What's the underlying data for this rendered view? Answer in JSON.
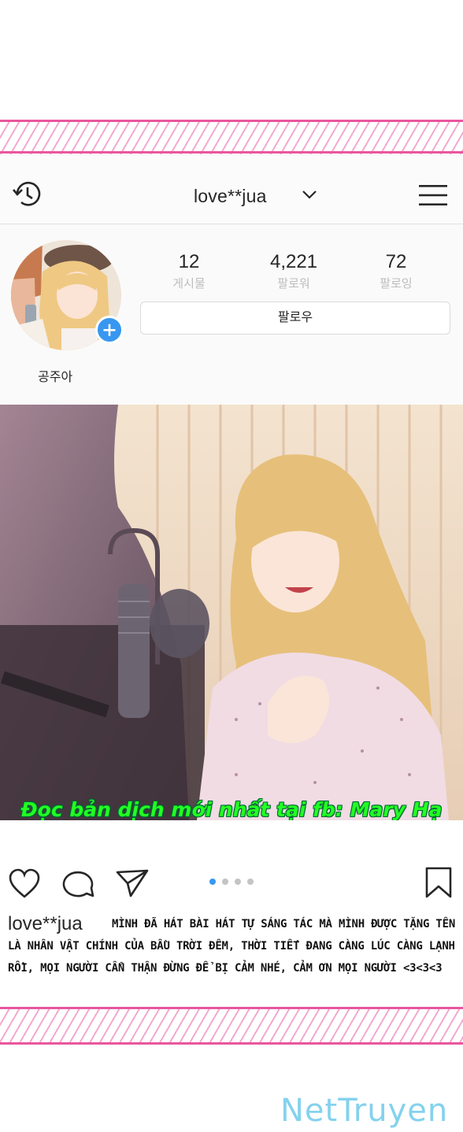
{
  "header": {
    "username": "love**jua"
  },
  "profile": {
    "stats": [
      {
        "value": "12",
        "label": "게시물"
      },
      {
        "value": "4,221",
        "label": "팔로워"
      },
      {
        "value": "72",
        "label": "팔로잉"
      }
    ],
    "follow_label": "팔로우",
    "display_name": "공주아"
  },
  "post": {
    "watermark": "Đọc bản dịch mới nhất tại fb: Mary Hạ Lục",
    "carousel_count": 4,
    "carousel_active": 1
  },
  "caption": {
    "username": "love**jua",
    "text": "MÌNH ĐÃ HÁT BÀI HÁT TỰ SÁNG TÁC MÀ MÌNH ĐƯỢC TẶNG TÊN LÀ NHÂN VẬT CHÍNH CỦA BẦU TRỜI ĐÊM, THỜI TIẾT ĐANG CÀNG LÚC CÀNG LẠNH RỒI, MỌI NGƯỜI CẨN THẬN ĐỪNG ĐỂ BỊ CẢM NHÉ, CẢM ƠN MỌI NGƯỜI <3<3<3"
  },
  "site_logo": "NetTruyen",
  "colors": {
    "accent_pink": "#e8579d",
    "instagram_blue": "#3897f0",
    "watermark_green": "#22ff22"
  },
  "icons": [
    "history-icon",
    "chevron-down-icon",
    "menu-icon",
    "add-icon",
    "heart-icon",
    "comment-icon",
    "send-icon",
    "bookmark-icon"
  ]
}
